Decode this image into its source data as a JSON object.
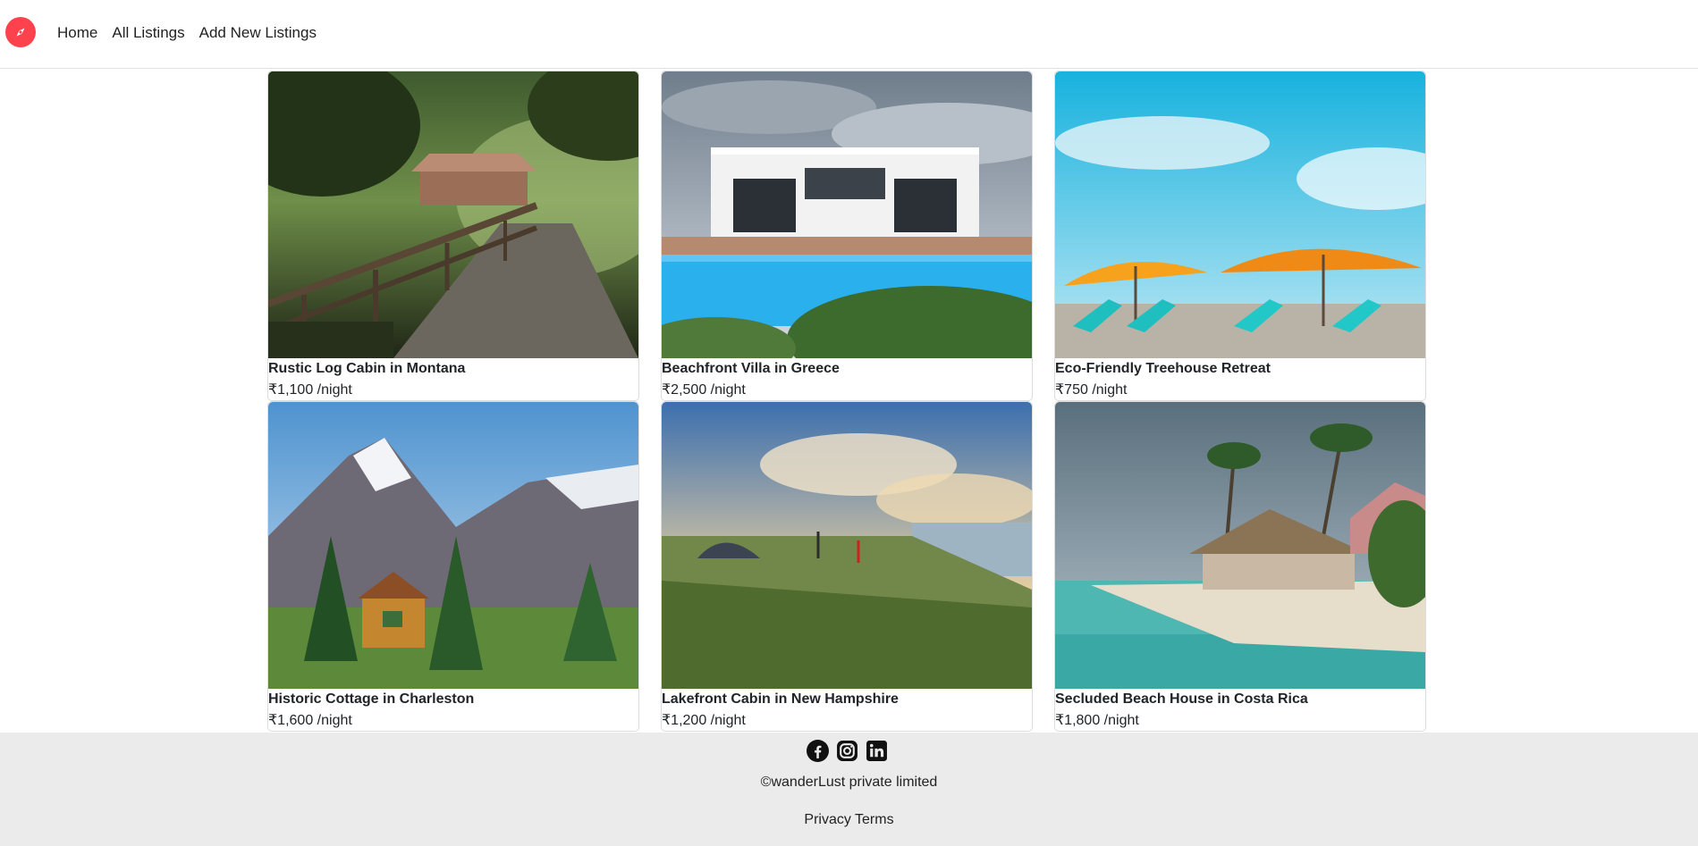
{
  "nav": {
    "logo_icon": "compass-icon",
    "brand_color": "#fe424d",
    "links": [
      "Home",
      "All Listings",
      "Add New Listings"
    ]
  },
  "listings": [
    {
      "title": "Rustic Log Cabin in Montana",
      "price": "₹1,100 /night",
      "image": "forest-path-with-wooden-railing-and-cabin"
    },
    {
      "title": "Beachfront Villa in Greece",
      "price": "₹2,500 /night",
      "image": "modern-white-villa-with-pool"
    },
    {
      "title": "Eco-Friendly Treehouse Retreat",
      "price": "₹750 /night",
      "image": "beach-umbrellas-and-lounge-chairs"
    },
    {
      "title": "Historic Cottage in Charleston",
      "price": "₹1,600 /night",
      "image": "log-cabin-below-snowy-mountain"
    },
    {
      "title": "Lakefront Cabin in New Hampshire",
      "price": "₹1,200 /night",
      "image": "tent-on-grassy-cliff-at-sunset"
    },
    {
      "title": "Secluded Beach House in Costa Rica",
      "price": "₹1,800 /night",
      "image": "thatched-beach-house-with-palms"
    }
  ],
  "footer": {
    "socials": [
      "facebook-icon",
      "instagram-icon",
      "linkedin-icon"
    ],
    "copyright": "©wanderLust private limited",
    "privacy": "Privacy",
    "terms": "Terms",
    "background": "#ebebeb"
  }
}
